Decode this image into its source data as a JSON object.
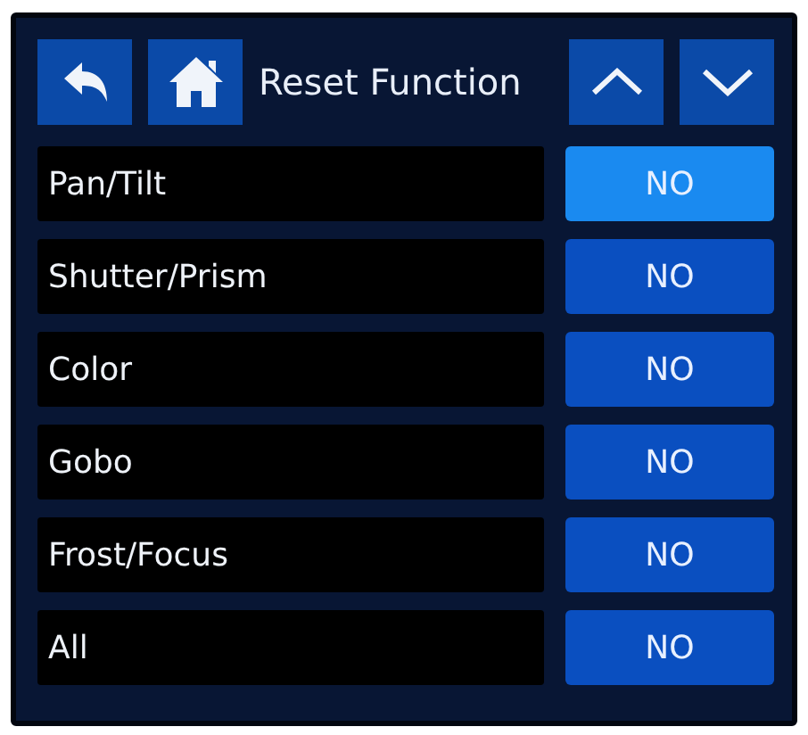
{
  "header": {
    "title": "Reset Function"
  },
  "rows": [
    {
      "label": "Pan/Tilt",
      "value": "NO",
      "selected": true
    },
    {
      "label": "Shutter/Prism",
      "value": "NO",
      "selected": false
    },
    {
      "label": "Color",
      "value": "NO",
      "selected": false
    },
    {
      "label": "Gobo",
      "value": "NO",
      "selected": false
    },
    {
      "label": "Frost/Focus",
      "value": "NO",
      "selected": false
    },
    {
      "label": "All",
      "value": "NO",
      "selected": false
    }
  ]
}
